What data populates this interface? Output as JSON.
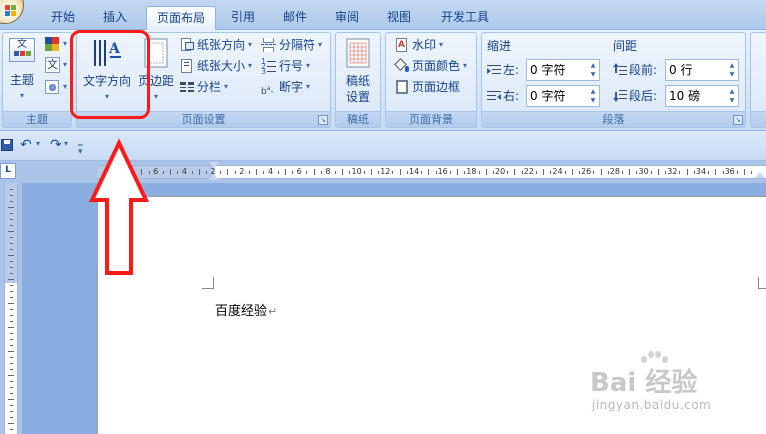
{
  "tabs": [
    {
      "label": "开始"
    },
    {
      "label": "插入"
    },
    {
      "label": "页面布局",
      "active": true
    },
    {
      "label": "引用"
    },
    {
      "label": "邮件"
    },
    {
      "label": "审阅"
    },
    {
      "label": "视图"
    },
    {
      "label": "开发工具"
    }
  ],
  "groups": {
    "theme": {
      "label": "主题",
      "theme_button": "主题",
      "theme_icon_text": "文",
      "font_icon_text": "文"
    },
    "page_setup": {
      "label": "页面设置",
      "text_direction": "文字方向",
      "margins": "页边距",
      "orientation": "纸张方向",
      "size": "纸张大小",
      "columns": "分栏",
      "breaks": "分隔符",
      "line_numbers": "行号",
      "hyphenation": "断字"
    },
    "manuscript": {
      "label": "稿纸",
      "button_line1": "稿纸",
      "button_line2": "设置"
    },
    "page_background": {
      "label": "页面背景",
      "watermark": "水印",
      "page_color": "页面颜色",
      "page_borders": "页面边框"
    },
    "paragraph": {
      "label": "段落",
      "indent_title": "缩进",
      "spacing_title": "间距",
      "indent_left_label": "左:",
      "indent_left_value": "0 字符",
      "indent_right_label": "右:",
      "indent_right_value": "0 字符",
      "spacing_before_label": "段前:",
      "spacing_before_value": "0 行",
      "spacing_after_label": "段后:",
      "spacing_after_value": "10 磅"
    }
  },
  "ruler": {
    "ruler_tab_symbol": "L",
    "ticks": [
      "8",
      "6",
      "4",
      "2",
      "2",
      "4",
      "6",
      "8",
      "10",
      "12",
      "14",
      "16",
      "18",
      "20",
      "22",
      "24",
      "26",
      "28",
      "30",
      "32",
      "34",
      "36"
    ]
  },
  "document": {
    "text": "百度经验",
    "paragraph_mark": "↵"
  },
  "watermark": {
    "main": "Bai 经验",
    "sub": "jingyan.baidu.com"
  },
  "colors": {
    "highlight": "#ff1a1a",
    "ribbon_text": "#15428b",
    "page_bg": "#ffffff",
    "workspace_bg": "#8aaee0"
  }
}
